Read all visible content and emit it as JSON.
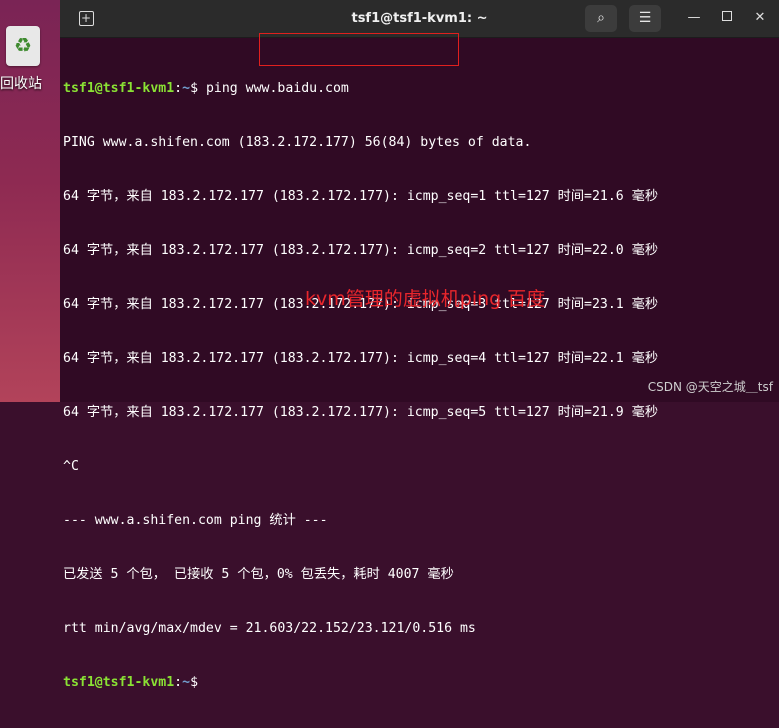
{
  "desktop": {
    "trash_label": "回收站",
    "trash_icon": "recycle-icon"
  },
  "window": {
    "title": "tsf1@tsf1-kvm1: ~",
    "buttons": {
      "new_tab_icon": "new-tab-icon",
      "search_icon": "search-icon",
      "menu_icon": "hamburger-menu-icon",
      "minimize_icon": "minimize-icon",
      "maximize_icon": "maximize-icon",
      "close_icon": "close-icon"
    }
  },
  "terminal": {
    "prompt_user": "tsf1@tsf1-kvm1",
    "prompt_sep": ":",
    "prompt_path": "~",
    "prompt_end": "$",
    "command": " ping www.baidu.com",
    "lines": [
      "PING www.a.shifen.com (183.2.172.177) 56(84) bytes of data.",
      "64 字节，来自 183.2.172.177 (183.2.172.177): icmp_seq=1 ttl=127 时间=21.6 毫秒",
      "64 字节，来自 183.2.172.177 (183.2.172.177): icmp_seq=2 ttl=127 时间=22.0 毫秒",
      "64 字节，来自 183.2.172.177 (183.2.172.177): icmp_seq=3 ttl=127 时间=23.1 毫秒",
      "64 字节，来自 183.2.172.177 (183.2.172.177): icmp_seq=4 ttl=127 时间=22.1 毫秒",
      "64 字节，来自 183.2.172.177 (183.2.172.177): icmp_seq=5 ttl=127 时间=21.9 毫秒",
      "^C",
      "--- www.a.shifen.com ping 统计 ---",
      "已发送 5 个包， 已接收 5 个包，0% 包丢失，耗时 4007 毫秒",
      "rtt min/avg/max/mdev = 21.603/22.152/23.121/0.516 ms"
    ]
  },
  "annotation": "kvm管理的虚拟机ping 百度",
  "watermark": "CSDN @天空之城＿tsf",
  "colors": {
    "terminal_bg": "#300a24",
    "prompt_user": "#8ae234",
    "prompt_path": "#729fcf",
    "highlight": "#e0201e",
    "annotation": "#e8262c"
  }
}
